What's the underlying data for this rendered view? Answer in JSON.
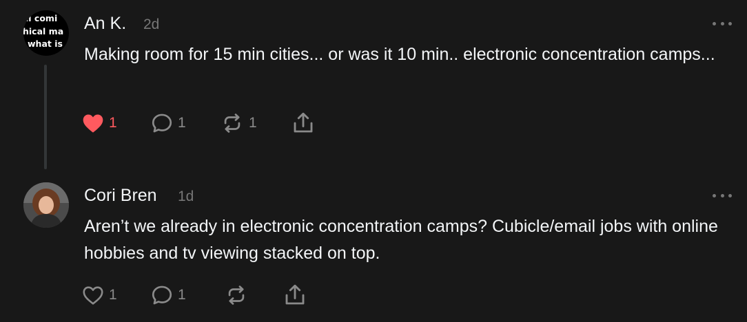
{
  "posts": [
    {
      "author": "An K.",
      "time": "2d",
      "avatar_text": [
        "ll comi",
        "hical ma",
        "what is"
      ],
      "text": "Making room for 15 min cities... or was it 10 min.. electronic concentration camps...",
      "liked": true,
      "likes": "1",
      "replies": "1",
      "reposts": "1"
    },
    {
      "author": "Cori Bren",
      "time": "1d",
      "text": "Aren’t we already in electronic concentration camps? Cubicle/email jobs with online hobbies and tv viewing stacked on top.",
      "liked": false,
      "likes": "1",
      "replies": "1",
      "reposts": ""
    }
  ],
  "colors": {
    "background": "#181818",
    "text": "#f3f5f7",
    "muted": "#8a8a8a",
    "like": "#ff5a5f"
  },
  "icons": [
    "heart-icon",
    "reply-icon",
    "repost-icon",
    "share-icon",
    "more-icon"
  ]
}
